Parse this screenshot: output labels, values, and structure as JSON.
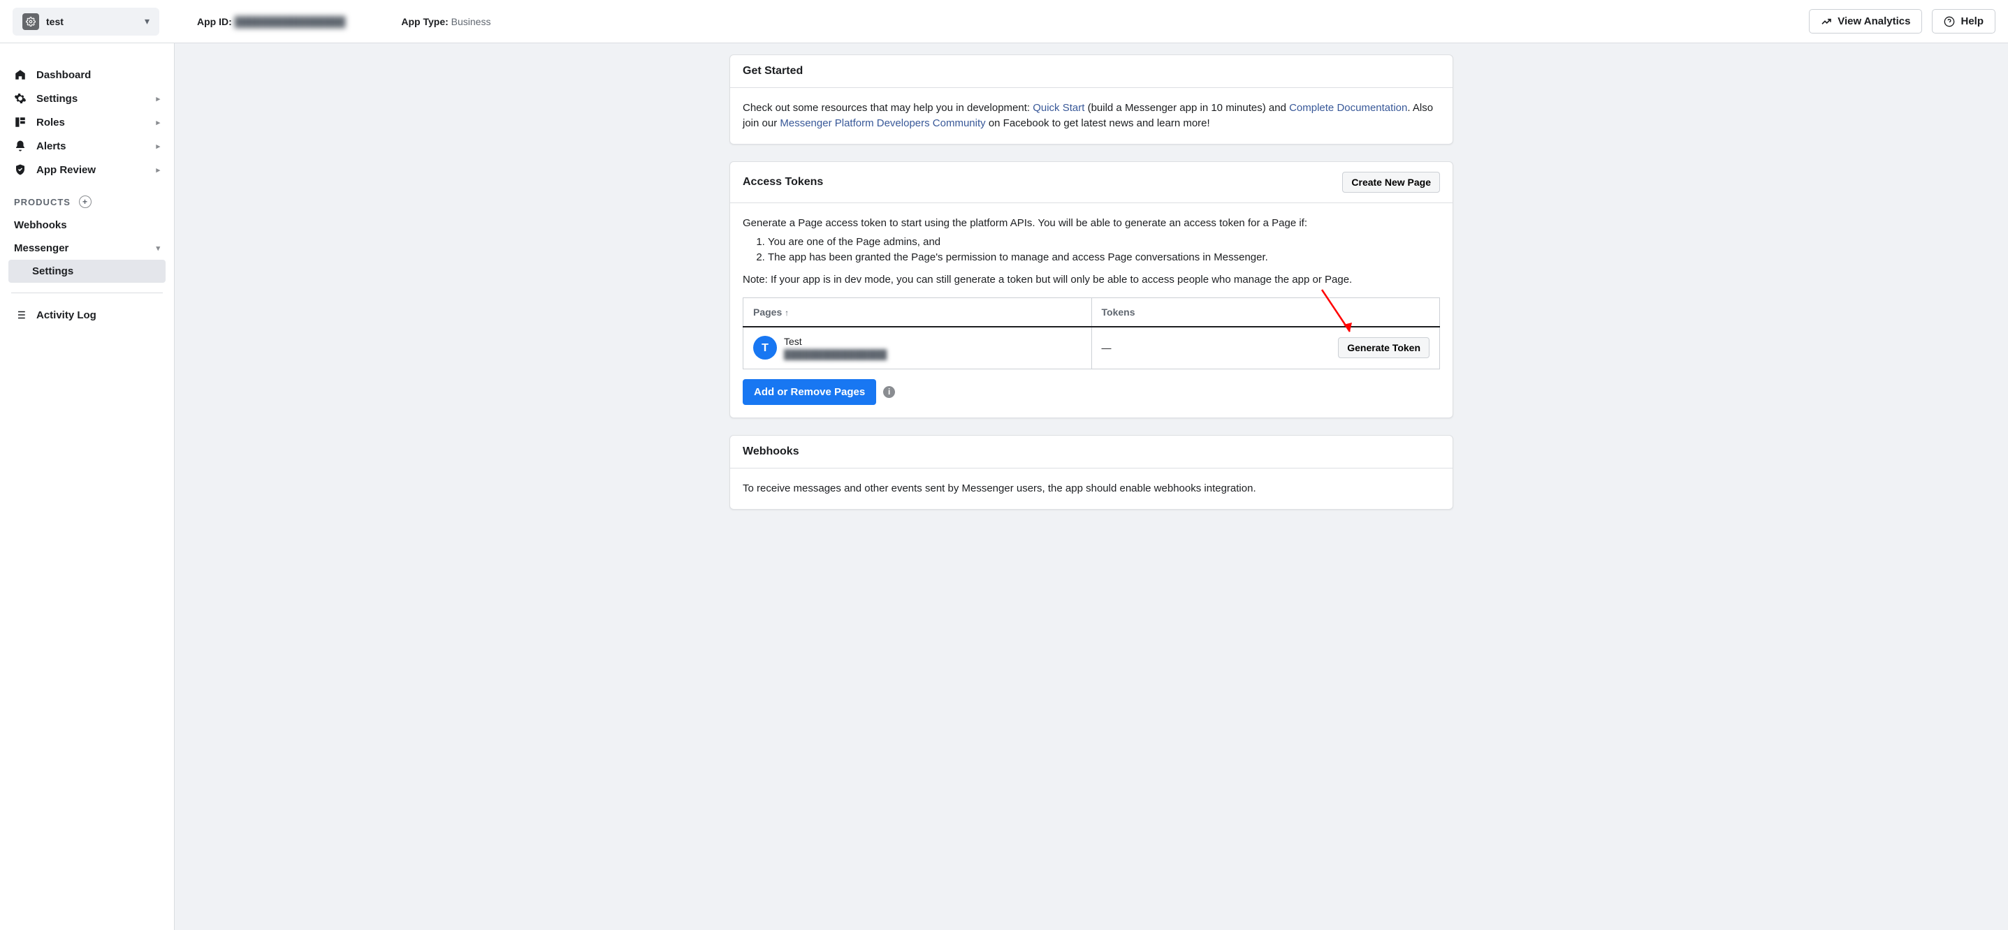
{
  "topbar": {
    "app_name": "test",
    "app_id_label": "App ID:",
    "app_id_value": "████████████████",
    "app_type_label": "App Type:",
    "app_type_value": "Business",
    "view_analytics": "View Analytics",
    "help": "Help"
  },
  "sidebar": {
    "dashboard": "Dashboard",
    "settings": "Settings",
    "roles": "Roles",
    "alerts": "Alerts",
    "app_review": "App Review",
    "products_label": "PRODUCTS",
    "webhooks": "Webhooks",
    "messenger": "Messenger",
    "messenger_settings": "Settings",
    "activity_log": "Activity Log"
  },
  "get_started": {
    "title": "Get Started",
    "intro_pre": "Check out some resources that may help you in development: ",
    "quick_start": "Quick Start",
    "intro_mid1": " (build a Messenger app in 10 minutes) and ",
    "complete_docs": "Complete Documentation",
    "intro_mid2": ". Also join our ",
    "community": "Messenger Platform Developers Community",
    "intro_post": " on Facebook to get latest news and learn more!"
  },
  "access_tokens": {
    "title": "Access Tokens",
    "create_new_page": "Create New Page",
    "description": "Generate a Page access token to start using the platform APIs. You will be able to generate an access token for a Page if:",
    "req1": "You are one of the Page admins, and",
    "req2": "The app has been granted the Page's permission to manage and access Page conversations in Messenger.",
    "note": "Note: If your app is in dev mode, you can still generate a token but will only be able to access people who manage the app or Page.",
    "col_pages": "Pages",
    "col_tokens": "Tokens",
    "page_badge_letter": "T",
    "page_name": "Test",
    "page_id": "████████████████",
    "token_dash": "—",
    "generate_token": "Generate Token",
    "add_remove_pages": "Add or Remove Pages"
  },
  "webhooks": {
    "title": "Webhooks",
    "description": "To receive messages and other events sent by Messenger users, the app should enable webhooks integration."
  }
}
